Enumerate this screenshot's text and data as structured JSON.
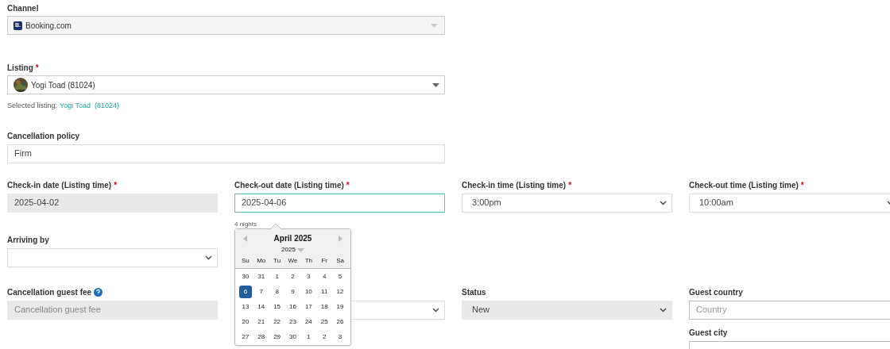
{
  "channel": {
    "label": "Channel",
    "logo_text": "B.",
    "value": "Booking.com",
    "disabled": true
  },
  "listing": {
    "label": "Listing",
    "required": "*",
    "value": "Yogi Toad (81024)",
    "selected_prefix": "Selected listing:",
    "selected_link": "Yogi Toad  (81024)"
  },
  "cancellation_policy": {
    "label": "Cancellation policy",
    "value": "Firm"
  },
  "dates_row": [
    {
      "kind": "date",
      "label": "Check-in date (Listing time)",
      "required": "*",
      "value": "2025-04-02",
      "disabled": true,
      "focused": false
    },
    {
      "kind": "date",
      "label": "Check-out date (Listing time)",
      "required": "*",
      "value": "2025-04-06",
      "disabled": false,
      "focused": true,
      "hint": "4 nights"
    },
    {
      "kind": "select",
      "label": "Check-in time (Listing time)",
      "required": "*",
      "value": "3:00pm",
      "disabled": false,
      "focused": false
    },
    {
      "kind": "select",
      "label": "Check-out time (Listing time)",
      "required": "*",
      "value": "10:00am",
      "disabled": false,
      "focused": false
    }
  ],
  "arriving_by": {
    "label": "Arriving by"
  },
  "fees_row": [
    {
      "kind": "text",
      "label": "Cancellation guest fee",
      "help": true,
      "placeholder": "Cancellation guest fee",
      "disabled": true
    },
    {
      "kind": "select",
      "disabled": false
    },
    {
      "kind": "select",
      "label": "Status",
      "value": "New",
      "disabled": true
    },
    {
      "kind": "combo",
      "label": "Guest country",
      "placeholder": "Country",
      "disabled": false
    }
  ],
  "guest_city": {
    "label": "Guest city"
  },
  "calendar": {
    "title": "April 2025",
    "year": "2025",
    "weekdays": [
      "Su",
      "Mo",
      "Tu",
      "We",
      "Th",
      "Fr",
      "Sa"
    ],
    "days": [
      {
        "label": "30",
        "selected": false
      },
      {
        "label": "31",
        "selected": false
      },
      {
        "label": "1",
        "selected": false
      },
      {
        "label": "2",
        "selected": false
      },
      {
        "label": "3",
        "selected": false
      },
      {
        "label": "4",
        "selected": false
      },
      {
        "label": "5",
        "selected": false
      },
      {
        "label": "6",
        "selected": true
      },
      {
        "label": "7",
        "selected": false
      },
      {
        "label": "8",
        "selected": false
      },
      {
        "label": "9",
        "selected": false
      },
      {
        "label": "10",
        "selected": false
      },
      {
        "label": "11",
        "selected": false
      },
      {
        "label": "12",
        "selected": false
      },
      {
        "label": "13",
        "selected": false
      },
      {
        "label": "14",
        "selected": false
      },
      {
        "label": "15",
        "selected": false
      },
      {
        "label": "16",
        "selected": false
      },
      {
        "label": "17",
        "selected": false
      },
      {
        "label": "18",
        "selected": false
      },
      {
        "label": "19",
        "selected": false
      },
      {
        "label": "20",
        "selected": false
      },
      {
        "label": "21",
        "selected": false
      },
      {
        "label": "22",
        "selected": false
      },
      {
        "label": "23",
        "selected": false
      },
      {
        "label": "24",
        "selected": false
      },
      {
        "label": "25",
        "selected": false
      },
      {
        "label": "26",
        "selected": false
      },
      {
        "label": "27",
        "selected": false
      },
      {
        "label": "28",
        "selected": false
      },
      {
        "label": "29",
        "selected": false
      },
      {
        "label": "30",
        "selected": false
      },
      {
        "label": "1",
        "selected": false
      },
      {
        "label": "2",
        "selected": false
      },
      {
        "label": "3",
        "selected": false
      }
    ]
  }
}
